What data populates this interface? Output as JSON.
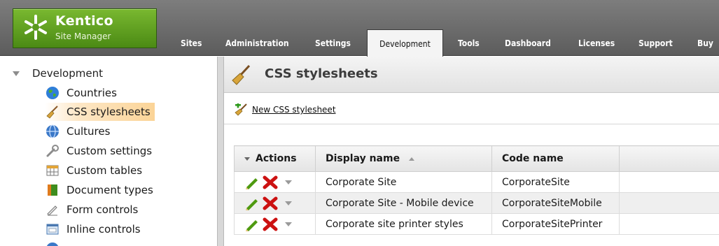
{
  "logo": {
    "brand": "Kentico",
    "subtitle": "Site Manager"
  },
  "tabs": [
    {
      "label": "Sites"
    },
    {
      "label": "Administration"
    },
    {
      "label": "Settings"
    },
    {
      "label": "Development",
      "active": true
    },
    {
      "label": "Tools"
    },
    {
      "label": "Dashboard"
    },
    {
      "label": "Licenses"
    },
    {
      "label": "Support"
    },
    {
      "label": "Buy"
    }
  ],
  "sidebar": {
    "root": "Development",
    "items": [
      {
        "label": "Countries",
        "icon": "globe-icon"
      },
      {
        "label": "CSS stylesheets",
        "icon": "broom-icon",
        "selected": true
      },
      {
        "label": "Cultures",
        "icon": "culture-globe-icon"
      },
      {
        "label": "Custom settings",
        "icon": "wrench-icon"
      },
      {
        "label": "Custom tables",
        "icon": "table-icon"
      },
      {
        "label": "Document types",
        "icon": "book-icon"
      },
      {
        "label": "Form controls",
        "icon": "pen-icon"
      },
      {
        "label": "Inline controls",
        "icon": "window-icon"
      }
    ]
  },
  "content": {
    "title": "CSS stylesheets",
    "new_link": "New CSS stylesheet",
    "grid": {
      "columns": {
        "actions": "Actions",
        "display_name": "Display name",
        "code_name": "Code name"
      },
      "rows": [
        {
          "display_name": "Corporate Site",
          "code_name": "CorporateSite"
        },
        {
          "display_name": "Corporate Site - Mobile device",
          "code_name": "CorporateSiteMobile"
        },
        {
          "display_name": "Corporate site printer styles",
          "code_name": "CorporateSitePrinter"
        }
      ]
    }
  },
  "colors": {
    "brand_green": "#5a9a1e",
    "selection": "#fbd497",
    "delete_red": "#cc1111",
    "edit_green": "#4e9a10"
  }
}
